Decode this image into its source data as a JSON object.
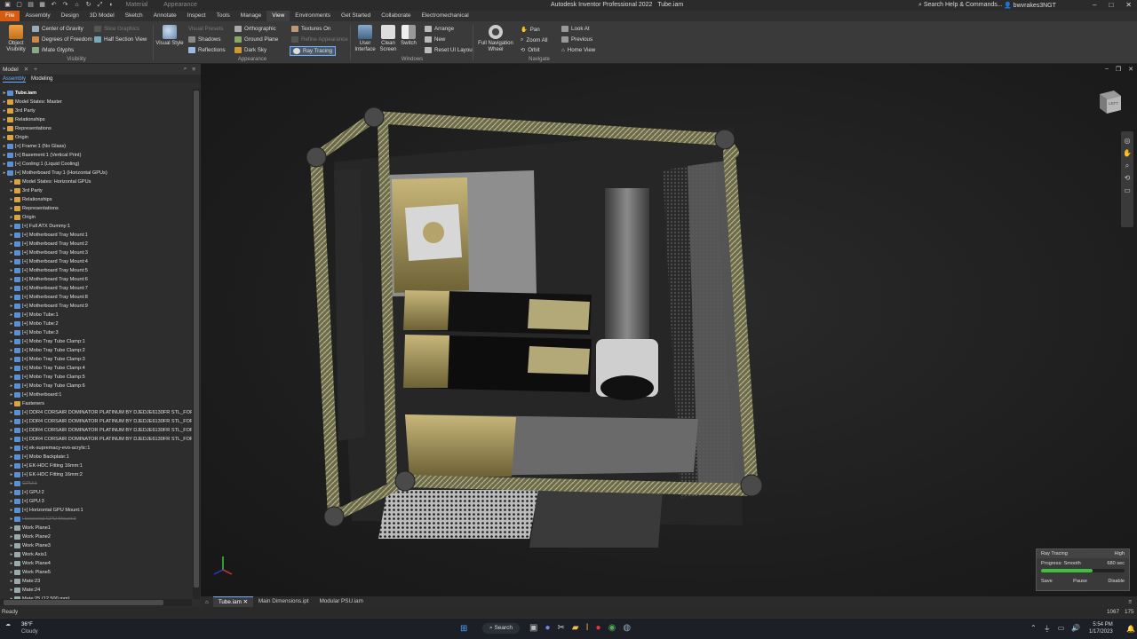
{
  "app": {
    "title": "Autodesk Inventor Professional 2022",
    "document": "Tube.iam",
    "search_placeholder": "Search Help & Commands...",
    "user": "bwvrakes3NGT",
    "qat_material": "Material",
    "qat_appearance": "Appearance"
  },
  "ribbon_tabs": [
    "File",
    "Assembly",
    "Design",
    "3D Model",
    "Sketch",
    "Annotate",
    "Inspect",
    "Tools",
    "Manage",
    "View",
    "Environments",
    "Get Started",
    "Collaborate",
    "Electromechanical"
  ],
  "ribbon_active_tab": "View",
  "ribbon": {
    "visibility": {
      "label": "Visibility",
      "object_visibility": "Object Visibility",
      "center_of_gravity": "Center of Gravity",
      "degrees_of_freedom": "Degrees of Freedom",
      "imate_glyphs": "iMate Glyphs",
      "slice_graphics": "Slice Graphics",
      "half_section_view": "Half Section View"
    },
    "appearance": {
      "label": "Appearance",
      "visual_style": "Visual Style",
      "visual_presets": "Visual Presets",
      "shadows": "Shadows",
      "reflections": "Reflections",
      "orthographic": "Orthographic",
      "ground_plane": "Ground Plane",
      "dark_sky": "Dark Sky",
      "textures_on": "Textures On",
      "refine_appearance": "Refine Appearance",
      "ray_tracing": "Ray Tracing"
    },
    "windows": {
      "label": "Windows",
      "user_interface": "User Interface",
      "clean_screen": "Clean Screen",
      "switch": "Switch",
      "arrange": "Arrange",
      "new": "New",
      "reset_ui_layout": "Reset UI Layout"
    },
    "navigate": {
      "label": "Navigate",
      "full_navigation_wheel": "Full Navigation Wheel",
      "pan": "Pan",
      "zoom_all": "Zoom All",
      "orbit": "Orbit",
      "look_at": "Look At",
      "previous": "Previous",
      "home_view": "Home View"
    }
  },
  "browser": {
    "title": "Model",
    "tabs": [
      "Assembly",
      "Modeling"
    ],
    "nodes": [
      {
        "t": "Tube.iam",
        "l": 0,
        "root": true
      },
      {
        "t": "Model States: Master",
        "l": 0
      },
      {
        "t": "3rd Party",
        "l": 0
      },
      {
        "t": "Relationships",
        "l": 0
      },
      {
        "t": "Representations",
        "l": 0
      },
      {
        "t": "Origin",
        "l": 0
      },
      {
        "t": "[+] Frame:1 (No Glass)",
        "l": 0
      },
      {
        "t": "[+] Basement:1 (Vertical Print)",
        "l": 0
      },
      {
        "t": "[+] Cooling:1 (Liquid Cooling)",
        "l": 0
      },
      {
        "t": "[+] Motherboard Tray:1 (Horizontal GPUs)",
        "l": 0
      },
      {
        "t": "Model States: Horizontal GPUs",
        "l": 1
      },
      {
        "t": "3rd Party",
        "l": 1
      },
      {
        "t": "Relationships",
        "l": 1
      },
      {
        "t": "Representations",
        "l": 1
      },
      {
        "t": "Origin",
        "l": 1
      },
      {
        "t": "[+] Full ATX Dummy:1",
        "l": 1
      },
      {
        "t": "[+] Motherboard Tray Mount:1",
        "l": 1
      },
      {
        "t": "[+] Motherboard Tray Mount:2",
        "l": 1
      },
      {
        "t": "[+] Motherboard Tray Mount:3",
        "l": 1
      },
      {
        "t": "[+] Motherboard Tray Mount:4",
        "l": 1
      },
      {
        "t": "[+] Motherboard Tray Mount:5",
        "l": 1
      },
      {
        "t": "[+] Motherboard Tray Mount:6",
        "l": 1
      },
      {
        "t": "[+] Motherboard Tray Mount:7",
        "l": 1
      },
      {
        "t": "[+] Motherboard Tray Mount:8",
        "l": 1
      },
      {
        "t": "[+] Motherboard Tray Mount:9",
        "l": 1
      },
      {
        "t": "[+] Mobo Tube:1",
        "l": 1
      },
      {
        "t": "[+] Mobo Tube:2",
        "l": 1
      },
      {
        "t": "[+] Mobo Tube:3",
        "l": 1
      },
      {
        "t": "[+] Mobo Tray Tube Clamp:1",
        "l": 1
      },
      {
        "t": "[+] Mobo Tray Tube Clamp:2",
        "l": 1
      },
      {
        "t": "[+] Mobo Tray Tube Clamp:3",
        "l": 1
      },
      {
        "t": "[+] Mobo Tray Tube Clamp:4",
        "l": 1
      },
      {
        "t": "[+] Mobo Tray Tube Clamp:5",
        "l": 1
      },
      {
        "t": "[+] Mobo Tray Tube Clamp:6",
        "l": 1
      },
      {
        "t": "[+] Motherboard:1",
        "l": 1
      },
      {
        "t": "Fasteners",
        "l": 1
      },
      {
        "t": "[+] DDR4 CORSAIR DOMINATOR PLATINUM BY DJEDJE6130FR STL_FORMAT",
        "l": 1
      },
      {
        "t": "[+] DDR4 CORSAIR DOMINATOR PLATINUM BY DJEDJE6130FR STL_FORMAT",
        "l": 1
      },
      {
        "t": "[+] DDR4 CORSAIR DOMINATOR PLATINUM BY DJEDJE6130FR STL_FORMAT",
        "l": 1
      },
      {
        "t": "[+] DDR4 CORSAIR DOMINATOR PLATINUM BY DJEDJE6130FR STL_FORMAT",
        "l": 1
      },
      {
        "t": "[+] ek-supremacy-evo-acrylic:1",
        "l": 1
      },
      {
        "t": "[+] Mobo Backplate:1",
        "l": 1
      },
      {
        "t": "[+] EK-HDC Fitting 16mm:1",
        "l": 1
      },
      {
        "t": "[+] EK-HDC Fitting 16mm:2",
        "l": 1
      },
      {
        "t": "GPU:1",
        "l": 1,
        "sup": true
      },
      {
        "t": "[+] GPU:2",
        "l": 1
      },
      {
        "t": "[+] GPU:3",
        "l": 1
      },
      {
        "t": "[+] Horizontal GPU Mount:1",
        "l": 1
      },
      {
        "t": "Horizontal GPU Mount:2",
        "l": 1,
        "sup": true
      },
      {
        "t": "Work Plane1",
        "l": 1
      },
      {
        "t": "Work Plane2",
        "l": 1
      },
      {
        "t": "Work Plane3",
        "l": 1
      },
      {
        "t": "Work Axis1",
        "l": 1
      },
      {
        "t": "Work Plane4",
        "l": 1
      },
      {
        "t": "Work Plane5",
        "l": 1
      },
      {
        "t": "Mate:23",
        "l": 1
      },
      {
        "t": "Mate:24",
        "l": 1
      },
      {
        "t": "Mate:25 (12.500 mm)",
        "l": 1
      }
    ]
  },
  "doc_tabs": [
    "Tube.iam",
    "Main Dimensions.ipt",
    "Modular PSU.iam"
  ],
  "status": {
    "left": "Ready",
    "n1": "1067",
    "n2": "175"
  },
  "ray_tracing": {
    "title": "Ray Tracing",
    "quality": "High",
    "progress_label": "Progress: Smooth",
    "time": "680 sec",
    "progress": 0.62,
    "save": "Save",
    "pause": "Pause",
    "disable": "Disable"
  },
  "viewcube_label": "LEFT",
  "taskbar": {
    "weather_temp": "36°F",
    "weather_desc": "Cloudy",
    "search": "Search",
    "time": "5:54 PM",
    "date": "1/17/2023"
  },
  "colors": {
    "accent": "#d85b12",
    "select": "#6fb0ff",
    "progress": "#3fbf3f"
  }
}
